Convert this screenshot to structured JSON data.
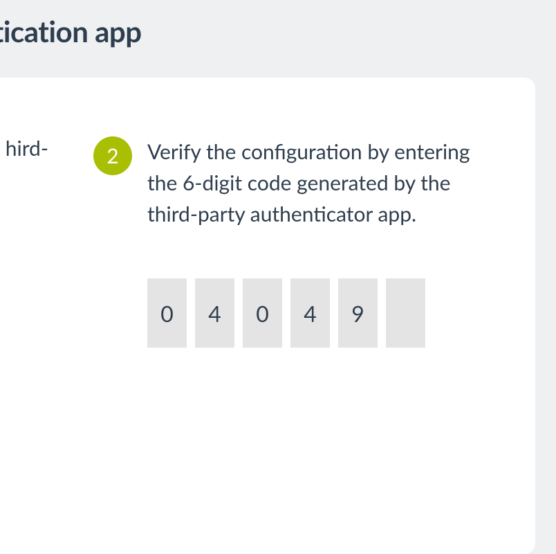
{
  "header": {
    "title_fragment": "tor authentication app"
  },
  "step1": {
    "text_fragment": "hird-"
  },
  "step2": {
    "badge": "2",
    "text": "Verify the configuration by entering the 6-digit code generated by the third-party authenticator app.",
    "code_digits": [
      "0",
      "4",
      "0",
      "4",
      "9",
      ""
    ]
  },
  "colors": {
    "accent": "#a9bf04",
    "text": "#2f3e4e",
    "page_bg": "#eef0f2",
    "input_bg": "#e4e4e4"
  }
}
